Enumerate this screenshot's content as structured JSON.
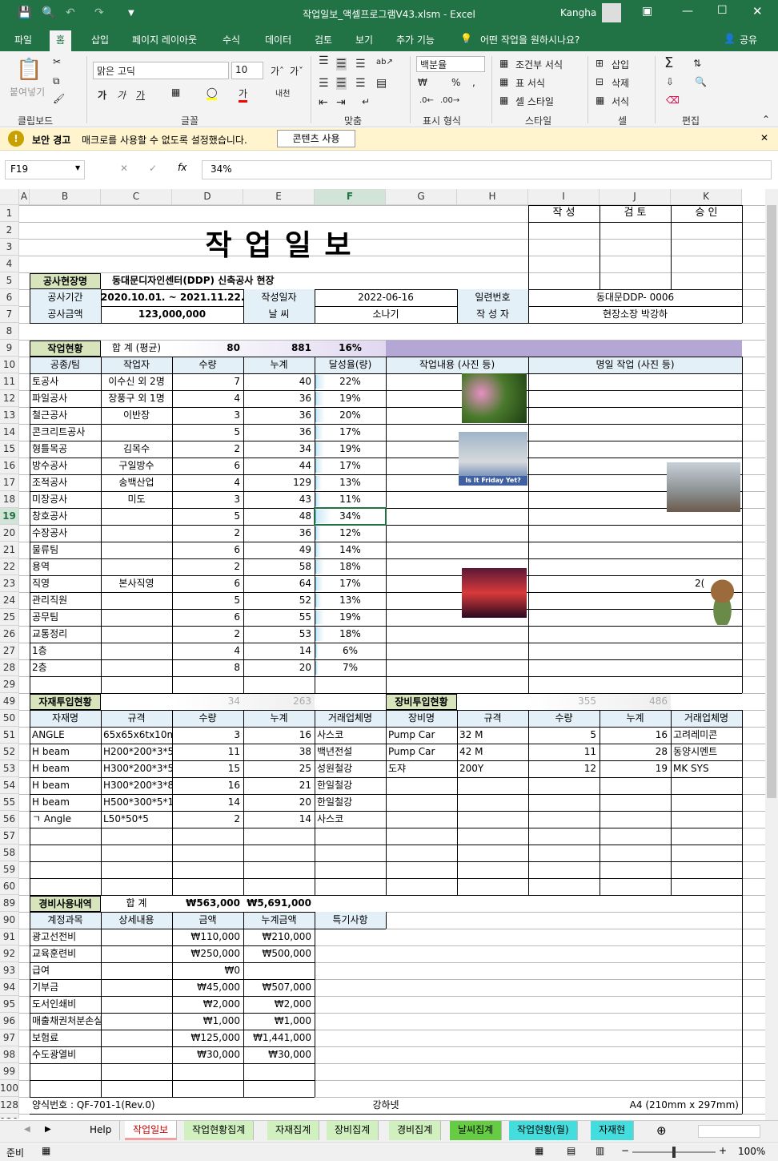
{
  "window": {
    "title": "작업일보_액셀프로그램V43.xlsm  -  Excel",
    "user": "Kangha"
  },
  "tabs": [
    "파일",
    "홈",
    "삽입",
    "페이지 레이아웃",
    "수식",
    "데이터",
    "검토",
    "보기",
    "추가 기능"
  ],
  "tell_me": "어떤 작업을 원하시나요?",
  "share": "공유",
  "ribbon": {
    "paste": "붙여넣기",
    "clipboard": "클립보드",
    "font_name": "맑은 고딕",
    "font_size": "10",
    "font": "글꼴",
    "align": "맞춤",
    "number_format": "백분율",
    "number": "표시 형식",
    "cond_format": "조건부 서식",
    "table_format": "표 서식",
    "cell_style": "셀 스타일",
    "style": "스타일",
    "insert": "삽입",
    "delete": "삭제",
    "format": "서식",
    "cells": "셀",
    "edit": "편집",
    "merge": "병합"
  },
  "msg": {
    "title": "보안 경고",
    "text": "매크로를 사용할 수 없도록 설정했습니다.",
    "button": "콘텐츠 사용"
  },
  "formula": {
    "name_box": "F19",
    "value": "34%"
  },
  "columns": [
    "A",
    "B",
    "C",
    "D",
    "E",
    "F",
    "G",
    "H",
    "I",
    "J",
    "K"
  ],
  "rows": [
    "1",
    "2",
    "3",
    "4",
    "5",
    "6",
    "7",
    "8",
    "9",
    "10",
    "11",
    "12",
    "13",
    "14",
    "15",
    "16",
    "17",
    "18",
    "19",
    "20",
    "21",
    "22",
    "23",
    "24",
    "25",
    "26",
    "27",
    "28",
    "29",
    "49",
    "50",
    "51",
    "52",
    "53",
    "54",
    "55",
    "56",
    "57",
    "58",
    "59",
    "60",
    "89",
    "90",
    "91",
    "92",
    "93",
    "94",
    "95",
    "96",
    "97",
    "98",
    "99",
    "100",
    "128",
    "129"
  ],
  "sheet": {
    "title": "작  업  일  보",
    "approval": [
      "작 성",
      "검 토",
      "승 인"
    ],
    "site_label": "공사현장명",
    "site": "동대문디자인센터(DDP) 신축공사 현장",
    "period_label": "공사기간",
    "period": "2020.10.01. ~ 2021.11.22.",
    "date_label": "작성일자",
    "date": "2022-06-16",
    "serial_label": "일련번호",
    "serial": "동대문DDP- 0006",
    "amount_label": "공사금액",
    "amount": "123,000,000",
    "weather_label": "날     씨",
    "weather": "소나기",
    "writer_label": "작 성 자",
    "writer": "현장소장  박강하",
    "work_label": "작업현황",
    "work_sum_label": "합 계 (평균)",
    "work_qty": "80",
    "work_cum": "881",
    "work_rate": "16%",
    "work_headers": [
      "공종/팀",
      "작업자",
      "수량",
      "누계",
      "달성율(량)",
      "작업내용 (사진 등)",
      "명일 작업 (사진 등)"
    ],
    "work_rows": [
      [
        "토공사",
        "이수신 외 2명",
        "7",
        "40",
        "22%"
      ],
      [
        "파일공사",
        "장풍구 외 1명",
        "4",
        "36",
        "19%"
      ],
      [
        "철근공사",
        "이반장",
        "3",
        "36",
        "20%"
      ],
      [
        "콘크리트공사",
        "",
        "5",
        "36",
        "17%"
      ],
      [
        "형틀목공",
        "김목수",
        "2",
        "34",
        "19%"
      ],
      [
        "방수공사",
        "구일방수",
        "6",
        "44",
        "17%"
      ],
      [
        "조적공사",
        "송백산업",
        "4",
        "129",
        "13%"
      ],
      [
        "미장공사",
        "미도",
        "3",
        "43",
        "11%"
      ],
      [
        "창호공사",
        "",
        "5",
        "48",
        "34%"
      ],
      [
        "수장공사",
        "",
        "2",
        "36",
        "12%"
      ],
      [
        "물류팀",
        "",
        "6",
        "49",
        "14%"
      ],
      [
        "용역",
        "",
        "2",
        "58",
        "18%"
      ],
      [
        "직영",
        "본사직영",
        "6",
        "64",
        "17%"
      ],
      [
        "관리직원",
        "",
        "5",
        "52",
        "13%"
      ],
      [
        "공무팀",
        "",
        "6",
        "55",
        "19%"
      ],
      [
        "교통정리",
        "",
        "2",
        "53",
        "18%"
      ],
      [
        "1층",
        "",
        "4",
        "14",
        "6%"
      ],
      [
        "2층",
        "",
        "8",
        "20",
        "7%"
      ]
    ],
    "photo_caption": "Is It Friday Yet?",
    "partial_text": "2(",
    "mat_label": "자재투입현황",
    "mat_qty": "34",
    "mat_cum": "263",
    "mat_headers": [
      "자재명",
      "규격",
      "수량",
      "누계",
      "거래업체명"
    ],
    "mat_rows": [
      [
        "ANGLE",
        "65x65x6tx10m",
        "3",
        "16",
        "사스코"
      ],
      [
        "H beam",
        "H200*200*3*5",
        "11",
        "38",
        "백년전설"
      ],
      [
        "H beam",
        "H300*200*3*5",
        "15",
        "25",
        "성원철강"
      ],
      [
        "H beam",
        "H300*200*3*8",
        "16",
        "21",
        "한일철강"
      ],
      [
        "H beam",
        "H500*300*5*12",
        "14",
        "20",
        "한일철강"
      ],
      [
        "ㄱ Angle",
        "L50*50*5",
        "2",
        "14",
        "사스코"
      ]
    ],
    "eq_label": "장비투입현황",
    "eq_qty": "355",
    "eq_cum": "486",
    "eq_headers": [
      "장비명",
      "규격",
      "수량",
      "누계",
      "거래업체명"
    ],
    "eq_rows": [
      [
        "Pump Car",
        "32 M",
        "5",
        "16",
        "고려레미콘"
      ],
      [
        "Pump Car",
        "42 M",
        "11",
        "28",
        "동양시멘트"
      ],
      [
        "도쟈",
        "200Y",
        "12",
        "19",
        "MK SYS"
      ]
    ],
    "exp_label": "경비사용내역",
    "exp_sum_label": "합 계",
    "exp_amount": "₩563,000",
    "exp_cum": "₩5,691,000",
    "exp_headers": [
      "계정과목",
      "상세내용",
      "금액",
      "누계금액",
      "특기사항"
    ],
    "exp_rows": [
      [
        "광고선전비",
        "",
        "₩110,000",
        "₩210,000"
      ],
      [
        "교육훈련비",
        "",
        "₩250,000",
        "₩500,000"
      ],
      [
        "급여",
        "",
        "₩0",
        ""
      ],
      [
        "기부금",
        "",
        "₩45,000",
        "₩507,000"
      ],
      [
        "도서인쇄비",
        "",
        "₩2,000",
        "₩2,000"
      ],
      [
        "매출채권처분손실",
        "",
        "₩1,000",
        "₩1,000"
      ],
      [
        "보험료",
        "",
        "₩125,000",
        "₩1,441,000"
      ],
      [
        "수도광열비",
        "",
        "₩30,000",
        "₩30,000"
      ]
    ],
    "footer_left": "양식번호 : QF-701-1(Rev.0)",
    "footer_mid": "강하넷",
    "footer_right": "A4  (210mm x 297mm)"
  },
  "sheet_tabs": [
    "Help",
    "작업일보",
    "작업현황집계",
    "자재집계",
    "장비집계",
    "경비집계",
    "날씨집계",
    "작업현황(월)",
    "자재현"
  ],
  "status": {
    "ready": "준비",
    "zoom": "100%"
  }
}
